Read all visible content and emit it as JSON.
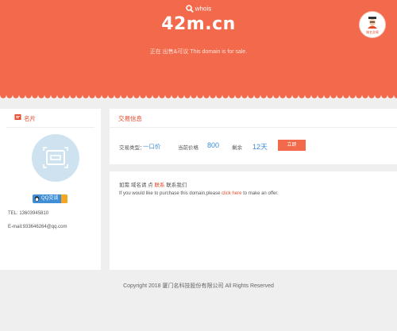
{
  "header": {
    "whois_label": "whois",
    "domain": "42m.cn",
    "sale_notice": "正在  出售&可议   This domain is for sale.",
    "badge_label": "域名交易"
  },
  "profile": {
    "title": "名片",
    "qq_label": "QQ交谈",
    "tel": "TEL: 13603945810",
    "email": "E-mail:933646264@qq.com"
  },
  "trade": {
    "title": "交易信息",
    "status_label": "交易类型：",
    "status_value": "一口价",
    "price_label": "当前价格",
    "price_value": "800",
    "duration_label": "剩余",
    "duration_value": "12天",
    "buy_button": "立即"
  },
  "contact": {
    "line1_a": "如需",
    "line1_b": "域名请",
    "line1_c": "点",
    "line1_link": "联系",
    "line1_d": "联系我们",
    "line2_a": "If you would like to purchase this domain,please ",
    "line2_link": "click here",
    "line2_b": " to make an offer."
  },
  "footer": {
    "copyright": "Copyright 2018 厦门名科技股份有限公司 All Rights Reserved"
  },
  "colors": {
    "header": "#f26a4b",
    "accent": "#e54a2a",
    "price": "#3b8cd4"
  }
}
